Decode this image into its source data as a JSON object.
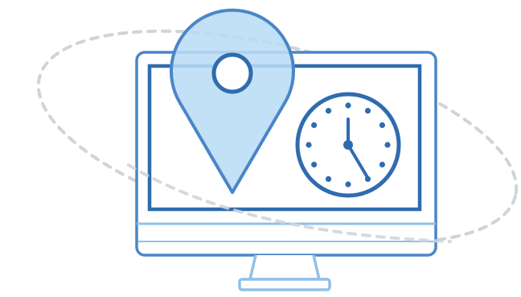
{
  "illustration": {
    "subject": "location-time-monitor",
    "icons": [
      "monitor-icon",
      "map-pin-icon",
      "clock-icon",
      "orbit-ring"
    ],
    "colors": {
      "dark_blue": "#2f6cae",
      "mid_blue": "#4a86c8",
      "light_blue": "#8fc0ea",
      "fill_blue": "#b9dcf5",
      "clock_face": "#ffffff",
      "orbit_gray": "#cfd4d9"
    },
    "clock": {
      "time": "5:00"
    }
  }
}
